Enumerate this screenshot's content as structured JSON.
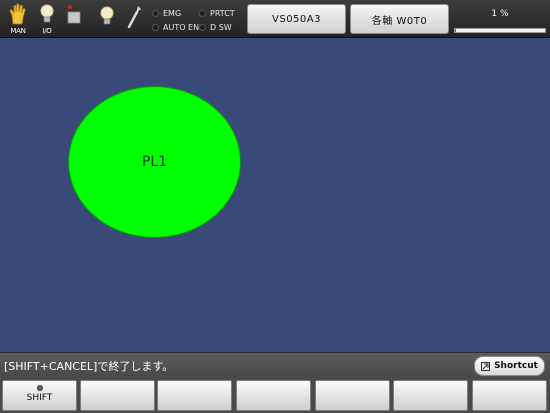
{
  "toolbar": {
    "mode_label": "MAN",
    "io_label": "I/O",
    "indicators": [
      {
        "label": "EMG"
      },
      {
        "label": "AUTO EN"
      },
      {
        "label": "PRTCT"
      },
      {
        "label": "D SW"
      }
    ],
    "robot_button": "VS050A3",
    "axis_button": "各軸 W0T0",
    "speed_text": "1 %",
    "speed_fraction": 0.01
  },
  "main": {
    "lamp_label": "PL1",
    "lamp_color": "#00ff00"
  },
  "status": {
    "message": "[SHIFT+CANCEL]で終了します。",
    "shortcut_label": "Shortcut"
  },
  "function_keys": [
    {
      "label": "SHIFT"
    },
    {
      "label": ""
    },
    {
      "label": ""
    },
    {
      "label": ""
    },
    {
      "label": ""
    },
    {
      "label": ""
    },
    {
      "label": ""
    }
  ]
}
